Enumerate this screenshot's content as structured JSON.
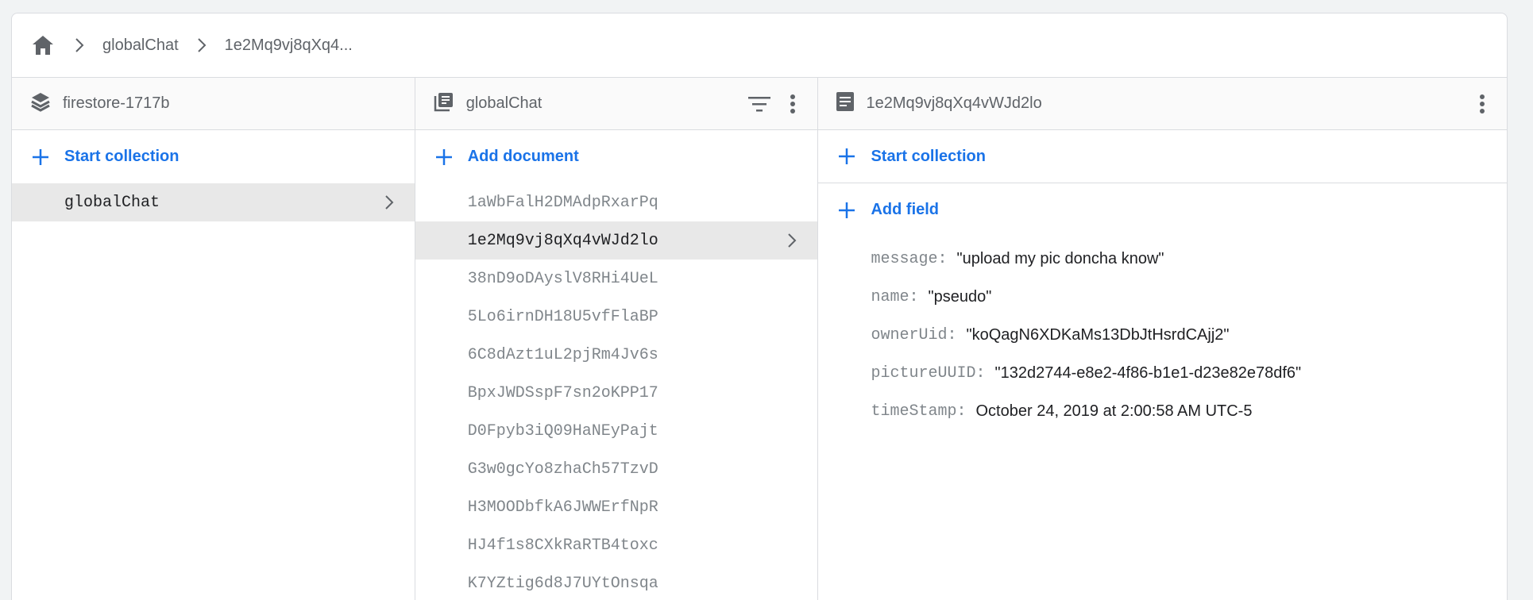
{
  "breadcrumb": {
    "items": [
      "globalChat",
      "1e2Mq9vj8qXq4..."
    ]
  },
  "columns": {
    "root": {
      "title": "firestore-1717b",
      "action_label": "Start collection",
      "collections": [
        {
          "name": "globalChat",
          "selected": true
        }
      ]
    },
    "collection": {
      "title": "globalChat",
      "action_label": "Add document",
      "documents": [
        "1aWbFalH2DMAdpRxarPq",
        "1e2Mq9vj8qXq4vWJd2lo",
        "38nD9oDAyslV8RHi4UeL",
        "5Lo6irnDH18U5vfFlaBP",
        "6C8dAzt1uL2pjRm4Jv6s",
        "BpxJWDSspF7sn2oKPP17",
        "D0Fpyb3iQ09HaNEyPajt",
        "G3w0gcYo8zhaCh57TzvD",
        "H3MOODbfkA6JWWErfNpR",
        "HJ4f1s8CXkRaRTB4toxc",
        "K7YZtig6d8J7UYtOnsqa"
      ],
      "selected_index": 1
    },
    "document": {
      "title": "1e2Mq9vj8qXq4vWJd2lo",
      "start_collection_label": "Start collection",
      "add_field_label": "Add field",
      "fields": [
        {
          "key": "message:",
          "value": "\"upload my pic doncha know\""
        },
        {
          "key": "name:",
          "value": "\"pseudo\""
        },
        {
          "key": "ownerUid:",
          "value": "\"koQagN6XDKaMs13DbJtHsrdCAjj2\""
        },
        {
          "key": "pictureUUID:",
          "value": "\"132d2744-e8e2-4f86-b1e1-d23e82e78df6\""
        },
        {
          "key": "timeStamp:",
          "value": "October 24, 2019 at 2:00:58 AM UTC-5"
        }
      ]
    }
  },
  "colors": {
    "accent": "#1a73e8",
    "selected_row": "#e8e8e8",
    "muted_text": "#80868b"
  },
  "icons": {
    "home": "home-icon",
    "chevron": "chevron-right-icon",
    "database": "database-layers-icon",
    "collection": "collection-icon",
    "document": "document-icon",
    "filter": "filter-icon",
    "more": "more-vert-icon",
    "add": "plus-icon"
  }
}
